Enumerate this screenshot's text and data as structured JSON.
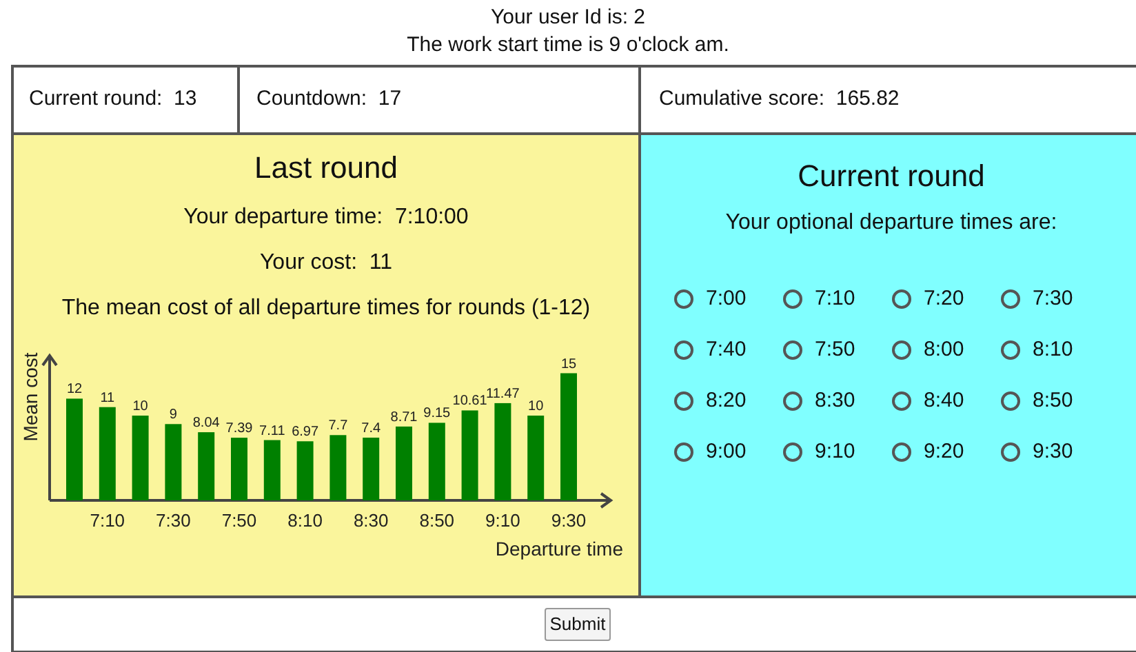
{
  "header": {
    "user_id_line": "Your user Id is: 2",
    "start_time_line": "The work start time is 9 o'clock am."
  },
  "status": {
    "round_label": "Current round:",
    "round": "13",
    "countdown_label": "Countdown:",
    "countdown": "17",
    "score_label": "Cumulative score:",
    "score": "165.82"
  },
  "last_round": {
    "title": "Last round",
    "departure_label": "Your departure time:",
    "departure": "7:10:00",
    "cost_label": "Your cost:",
    "cost": "11",
    "mean_caption": "The mean cost of all departure times for rounds (1-12)",
    "chart_data": {
      "type": "bar",
      "xlabel": "Departure time",
      "ylabel": "Mean cost",
      "categories": [
        null,
        "7:10",
        null,
        "7:30",
        null,
        "7:50",
        null,
        "8:10",
        null,
        "8:30",
        null,
        "8:50",
        null,
        "9:10",
        null,
        "9:30"
      ],
      "series": [
        {
          "color": "#008000",
          "values": [
            12,
            11,
            10,
            9,
            8.04,
            7.39,
            7.11,
            6.97,
            7.7,
            7.4,
            8.71,
            9.15,
            10.61,
            11.47,
            10,
            15
          ]
        }
      ],
      "data_labels": true
    }
  },
  "current_round": {
    "title": "Current round",
    "prompt": "Your optional departure times are:",
    "options": [
      {
        "label": "7:00",
        "selected": false
      },
      {
        "label": "7:10",
        "selected": false
      },
      {
        "label": "7:20",
        "selected": false
      },
      {
        "label": "7:30",
        "selected": false
      },
      {
        "label": "7:40",
        "selected": false
      },
      {
        "label": "7:50",
        "selected": false
      },
      {
        "label": "8:00",
        "selected": false
      },
      {
        "label": "8:10",
        "selected": false
      },
      {
        "label": "8:20",
        "selected": false
      },
      {
        "label": "8:30",
        "selected": false
      },
      {
        "label": "8:40",
        "selected": false
      },
      {
        "label": "8:50",
        "selected": false
      },
      {
        "label": "9:00",
        "selected": false
      },
      {
        "label": "9:10",
        "selected": false
      },
      {
        "label": "9:20",
        "selected": false
      },
      {
        "label": "9:30",
        "selected": false
      }
    ]
  },
  "submit": "Submit"
}
